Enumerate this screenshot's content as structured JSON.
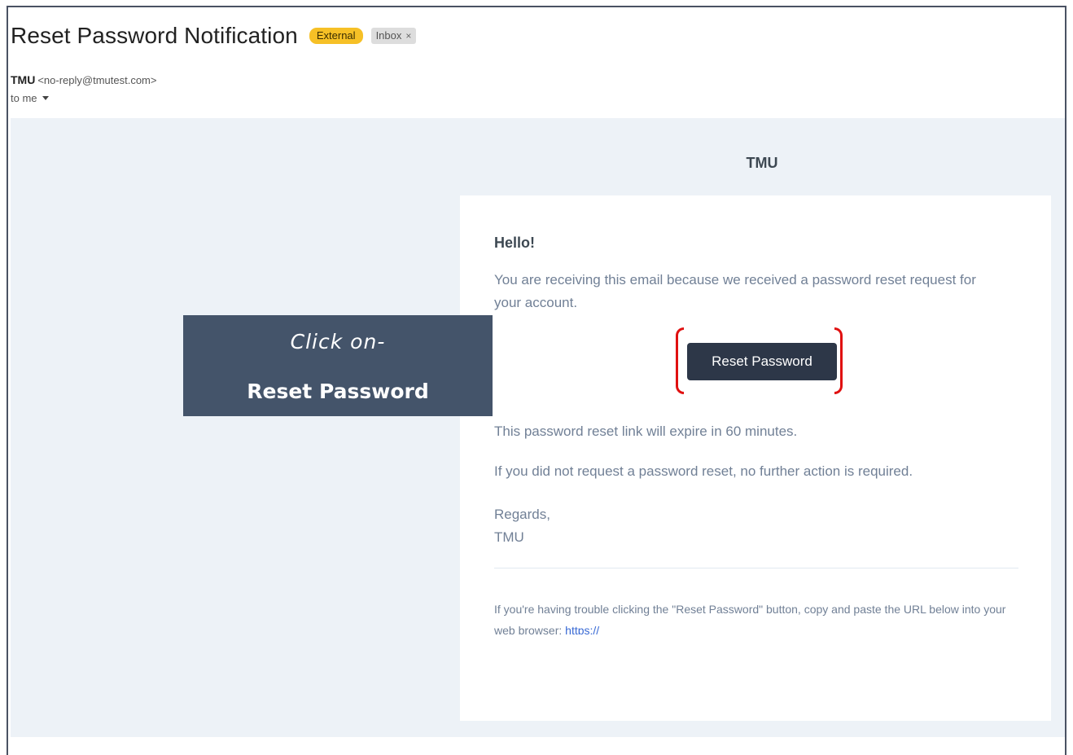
{
  "header": {
    "subject": "Reset Password Notification",
    "labels": {
      "external": "External",
      "inbox": "Inbox",
      "inbox_remove": "×"
    }
  },
  "sender": {
    "name": "TMU",
    "email": "<no-reply@tmutest.com>",
    "recipient": "to me"
  },
  "email": {
    "brand": "TMU",
    "greeting": "Hello!",
    "intro": "You are receiving this email because we received a password reset request for your account.",
    "button_label": "Reset Password",
    "expiry": "This password reset link will expire in 60 minutes.",
    "no_action": "If you did not request a password reset, no further action is required.",
    "regards_line1": "Regards,",
    "regards_line2": "TMU",
    "trouble_text": "If you're having trouble clicking the \"Reset Password\" button, copy and paste the URL below into your web browser: ",
    "trouble_link": "https://"
  },
  "callout": {
    "line1": "Click on-",
    "line2": "Reset Password"
  },
  "colors": {
    "button_bg": "#2d3748",
    "highlight": "#e01010",
    "callout_bg": "#44546a",
    "badge_external": "#f6c026"
  }
}
